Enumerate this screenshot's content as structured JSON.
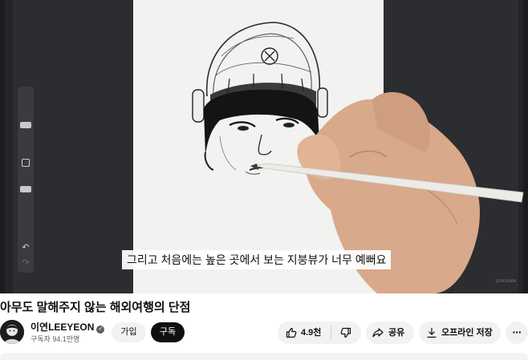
{
  "player": {
    "subtitle": "그리고 처음에는 높은 곳에서 보는 지붕뷰가 너무 예뻐요",
    "watermark": "procreate"
  },
  "video": {
    "title": "아무도 말해주지 않는 해외여행의 단점"
  },
  "channel": {
    "name": "이연LEEYEON",
    "verified_icon": "check-icon",
    "subscribers": "구독자 94.1만명"
  },
  "actions": {
    "join_label": "가입",
    "subscribe_label": "구독",
    "like_count": "4.9천",
    "share_label": "공유",
    "offline_label": "오프라인 저장",
    "more_label": "···"
  },
  "colors": {
    "subscribe_bg": "#0f0f0f",
    "pill_bg": "#f2f2f2",
    "secondary_text": "#606060"
  }
}
